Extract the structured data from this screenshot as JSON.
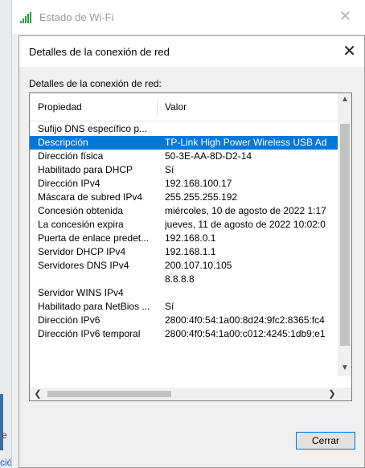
{
  "parent_window": {
    "title": "Estado de Wi-Fi",
    "close_glyph": "✕"
  },
  "dialog": {
    "title": "Detalles de la conexión de red",
    "close_glyph": "✕",
    "section_label": "Detalles de la conexión de red:",
    "columns": {
      "property": "Propiedad",
      "value": "Valor"
    },
    "rows": [
      {
        "property": "Sufijo DNS específico p...",
        "value": ""
      },
      {
        "property": "Descripción",
        "value": "TP-Link High Power Wireless USB Ad"
      },
      {
        "property": "Dirección física",
        "value": "50-3E-AA-8D-D2-14"
      },
      {
        "property": "Habilitado para DHCP",
        "value": "Sí"
      },
      {
        "property": "Dirección IPv4",
        "value": "192.168.100.17"
      },
      {
        "property": "Máscara de subred IPv4",
        "value": "255.255.255.192"
      },
      {
        "property": "Concesión obtenida",
        "value": "miércoles, 10 de agosto de 2022 1:17"
      },
      {
        "property": "La concesión expira",
        "value": "jueves, 11 de agosto de 2022 10:02:0"
      },
      {
        "property": "Puerta de enlace predet...",
        "value": "192.168.0.1"
      },
      {
        "property": "Servidor DHCP IPv4",
        "value": "192.168.1.1"
      },
      {
        "property": "Servidores DNS IPv4",
        "value": "200.107.10.105"
      },
      {
        "property": "",
        "value": "8.8.8.8"
      },
      {
        "property": "Servidor WINS IPv4",
        "value": ""
      },
      {
        "property": "Habilitado para NetBios ...",
        "value": "Sí"
      },
      {
        "property": "Dirección IPv6",
        "value": "2800:4f0:54:1a00:8d24:9fc2:8365:fc4"
      },
      {
        "property": "Dirección IPv6 temporal",
        "value": "2800:4f0:54:1a00:c012:4245:1db9:e1"
      }
    ],
    "selected_row_index": 1,
    "close_button_label": "Cerrar"
  },
  "background": {
    "side_char": "e",
    "bottom_text": "ción"
  },
  "colors": {
    "selection": "#0078d7",
    "dialog_bg": "#f0f0f0",
    "wifi_icon": "#2e9b3e"
  },
  "icons": {
    "wifi": "wifi-signal-icon",
    "scroll_up": "chevron-up-icon",
    "scroll_down": "chevron-down-icon",
    "scroll_left": "chevron-left-icon",
    "scroll_right": "chevron-right-icon"
  }
}
